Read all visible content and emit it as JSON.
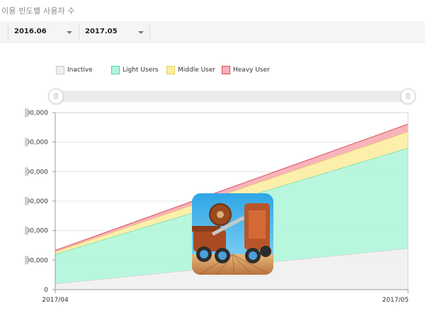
{
  "page": {
    "title": "이용 빈도별 사용자 수"
  },
  "filters": {
    "start": {
      "value": "2016.06"
    },
    "end": {
      "value": "2017.05"
    }
  },
  "legend": [
    {
      "label": "Inactive",
      "fill": "#f0f0f0",
      "stroke": "#c8c8c8"
    },
    {
      "label": "Light Users",
      "fill": "#b5f5dc",
      "stroke": "#4fd6a2"
    },
    {
      "label": "Middle User",
      "fill": "#fbeea6",
      "stroke": "#ead150"
    },
    {
      "label": "Heavy User",
      "fill": "#f7b0b6",
      "stroke": "#d9505e"
    }
  ],
  "range_slider": {
    "start_fraction": 0,
    "end_fraction": 1
  },
  "chart_data": {
    "type": "area",
    "stacked": true,
    "x": [
      "2017/04",
      "2017/05"
    ],
    "y_ticks": [
      "0",
      "00,000",
      "00,000",
      "00,000",
      "00,000",
      "00,000",
      "00,000"
    ],
    "ylim": [
      0,
      6
    ],
    "series": [
      {
        "name": "Inactive",
        "values": [
          0.2,
          1.4
        ],
        "fill": "#f0f0f0",
        "stroke": "#c8c8c8"
      },
      {
        "name": "Light Users",
        "values": [
          1.0,
          3.4
        ],
        "fill": "#b5f5dc",
        "stroke": "#4fd6a2"
      },
      {
        "name": "Middle User",
        "values": [
          0.08,
          0.55
        ],
        "fill": "#fbeea6",
        "stroke": "#ead150"
      },
      {
        "name": "Heavy User",
        "values": [
          0.05,
          0.26
        ],
        "fill": "#f7b0b6",
        "stroke": "#d9505e"
      }
    ],
    "grid": true
  }
}
